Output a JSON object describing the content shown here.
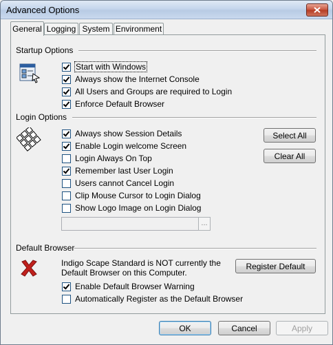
{
  "window": {
    "title": "Advanced Options"
  },
  "tabs": [
    {
      "label": "General",
      "active": true
    },
    {
      "label": "Logging",
      "active": false
    },
    {
      "label": "System",
      "active": false
    },
    {
      "label": "Environment",
      "active": false
    }
  ],
  "startup": {
    "title": "Startup Options",
    "items": [
      {
        "label": "Start with Windows",
        "checked": true
      },
      {
        "label": "Always show the Internet Console",
        "checked": true
      },
      {
        "label": "All Users and Groups are required to Login",
        "checked": true
      },
      {
        "label": "Enforce Default Browser",
        "checked": true
      }
    ]
  },
  "login": {
    "title": "Login Options",
    "items": [
      {
        "label": "Always show Session Details",
        "checked": true
      },
      {
        "label": "Enable Login welcome Screen",
        "checked": true
      },
      {
        "label": "Login Always On Top",
        "checked": false
      },
      {
        "label": "Remember last User Login",
        "checked": true
      },
      {
        "label": "Users cannot Cancel Login",
        "checked": false
      },
      {
        "label": "Clip Mouse Cursor to Login Dialog",
        "checked": false
      },
      {
        "label": "Show Logo Image on Login Dialog",
        "checked": false
      }
    ],
    "select_all": "Select All",
    "clear_all": "Clear All",
    "logo_path": "",
    "browse_label": "..."
  },
  "browser": {
    "title": "Default Browser",
    "status_line1": "Indigo Scape Standard is NOT currently the",
    "status_line2": "Default Browser on this Computer.",
    "register_label": "Register Default",
    "items": [
      {
        "label": "Enable Default Browser Warning",
        "checked": true
      },
      {
        "label": "Automatically Register as the Default Browser",
        "checked": false
      }
    ]
  },
  "footer": {
    "ok": "OK",
    "cancel": "Cancel",
    "apply": "Apply"
  }
}
